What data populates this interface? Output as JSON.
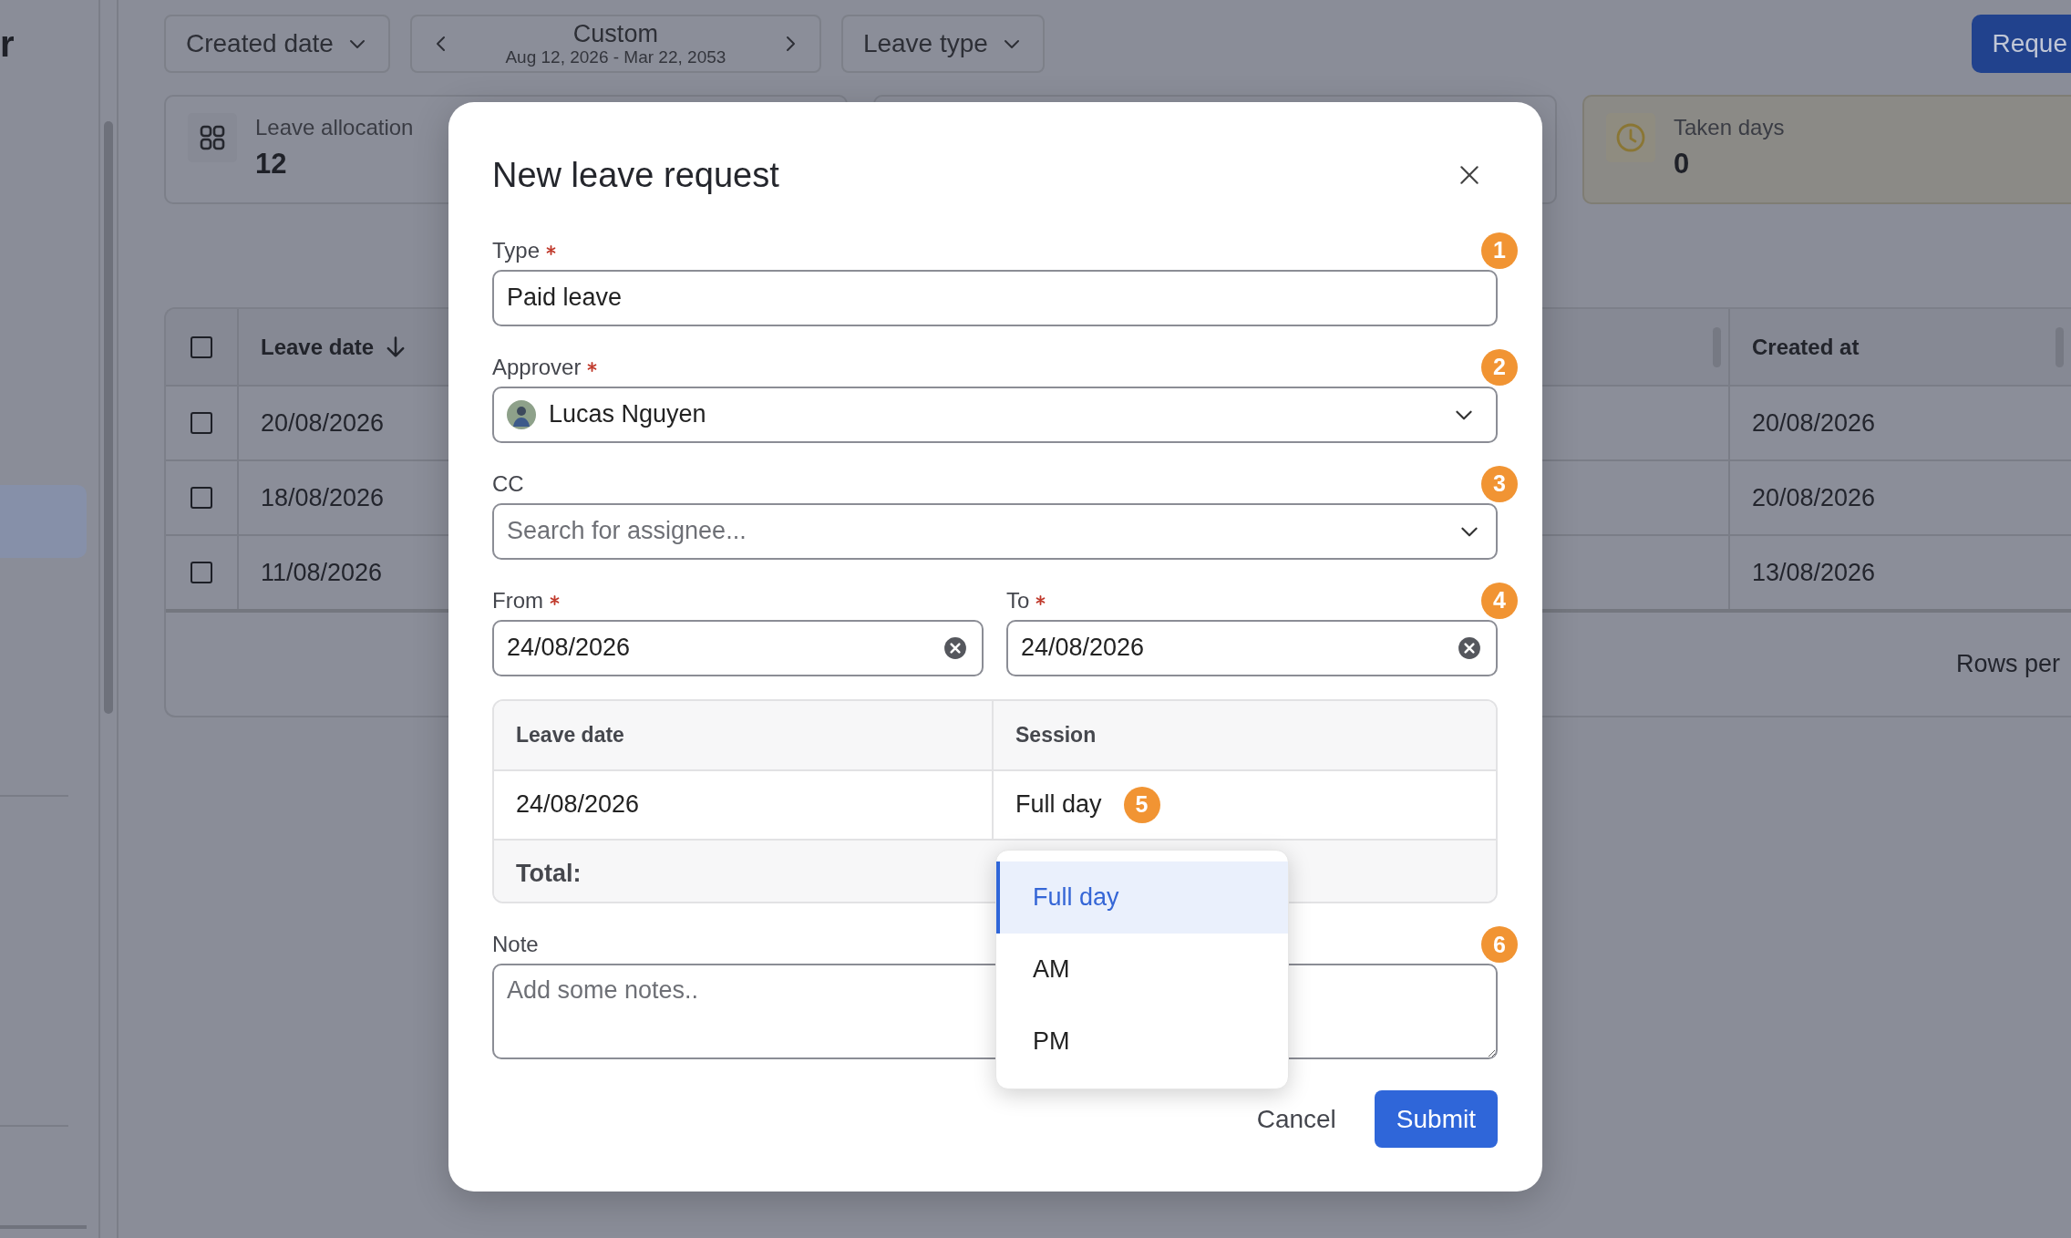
{
  "sidebar": {
    "heading": "r",
    "items": [
      {
        "selected": true
      }
    ]
  },
  "filters": [
    {
      "kind": "dropdown",
      "label": "Created date"
    },
    {
      "kind": "range",
      "label": "Custom",
      "sublabel": "Aug 12, 2026 - Mar 22, 2053"
    },
    {
      "kind": "dropdown",
      "label": "Leave type"
    }
  ],
  "primary_button": "Reque",
  "stats": [
    {
      "kind": "grid",
      "label": "Leave allocation",
      "value": "12"
    },
    {
      "kind": "covered"
    },
    {
      "kind": "clock",
      "label": "Taken days",
      "value": "0"
    }
  ],
  "table": {
    "header_checked": false,
    "columns": [
      {
        "label": "Leave date",
        "sorted": true
      },
      {
        "label": "Created at"
      }
    ],
    "rows": [
      {
        "checked": false,
        "leave_date": "20/08/2026",
        "created_at": "20/08/2026"
      },
      {
        "checked": false,
        "leave_date": "18/08/2026",
        "created_at": "20/08/2026"
      },
      {
        "checked": false,
        "leave_date": "11/08/2026",
        "created_at": "13/08/2026"
      }
    ],
    "footer": "Rows per"
  },
  "modal": {
    "title": "New leave request",
    "fields": [
      {
        "kind": "text",
        "label": "Type",
        "required": true,
        "value": "Paid leave",
        "badge": "1"
      },
      {
        "kind": "person",
        "label": "Approver",
        "required": true,
        "value": "Lucas Nguyen",
        "badge": "2"
      },
      {
        "kind": "search",
        "label": "CC",
        "required": false,
        "placeholder": "Search for assignee...",
        "badge": "3"
      },
      {
        "kind": "dates",
        "badge": "4",
        "parts": [
          {
            "label": "From",
            "required": true,
            "value": "24/08/2026"
          },
          {
            "label": "To",
            "required": true,
            "value": "24/08/2026"
          }
        ]
      }
    ],
    "session_table": {
      "columns": [
        "Leave date",
        "Session"
      ],
      "rows": [
        {
          "leave_date": "24/08/2026",
          "session": "Full day",
          "badge": "5"
        }
      ],
      "total_label": "Total:"
    },
    "note": {
      "label": "Note",
      "placeholder": "Add some notes..",
      "badge": "6"
    },
    "session_menu": [
      {
        "label": "Full day",
        "selected": true
      },
      {
        "label": "AM",
        "selected": false
      },
      {
        "label": "PM",
        "selected": false
      }
    ],
    "buttons": [
      {
        "kind": "secondary",
        "label": "Cancel"
      },
      {
        "kind": "primary",
        "label": "Submit"
      }
    ]
  }
}
